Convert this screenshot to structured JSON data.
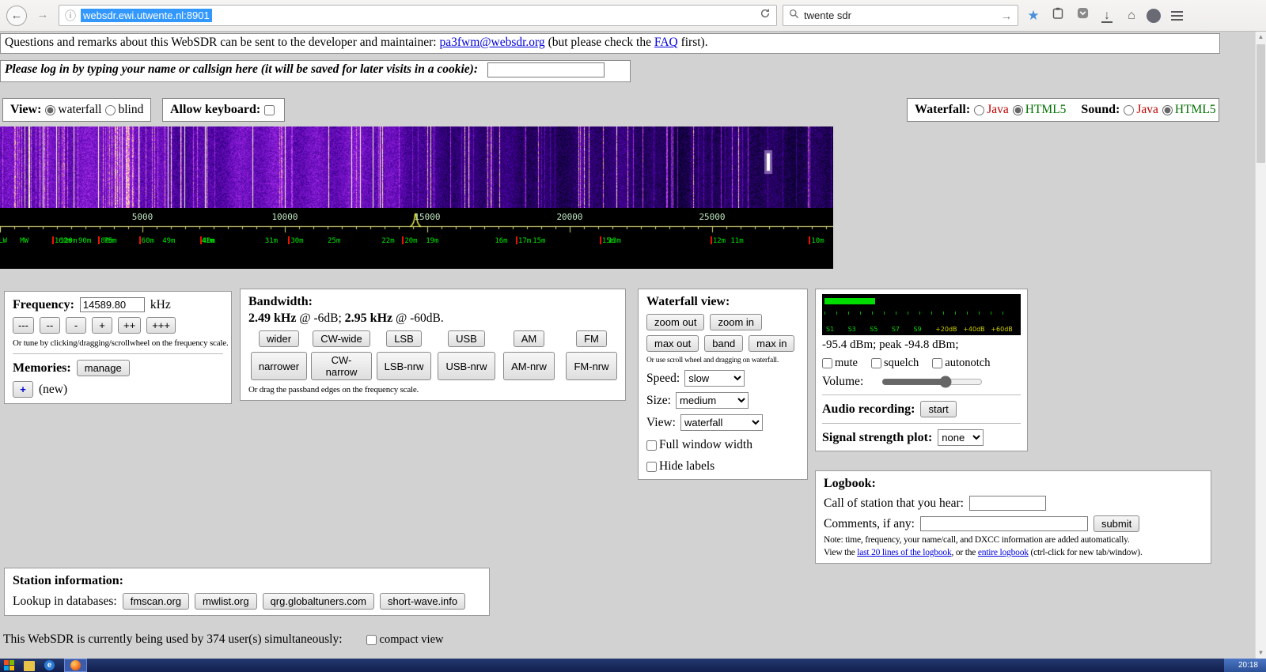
{
  "browser": {
    "url": "websdr.ewi.utwente.nl:8901",
    "search_value": "twente sdr",
    "clock": "20:18"
  },
  "remarks": {
    "pre": "Questions and remarks about this WebSDR can be sent to the developer and maintainer: ",
    "email": "pa3fwm@websdr.org",
    "mid": " (but please check the ",
    "faq": "FAQ",
    "post": " first)."
  },
  "login": {
    "label": "Please log in by typing your name or callsign here (it will be saved for later visits in a cookie):"
  },
  "view_bar": {
    "view_label": "View:",
    "waterfall": "waterfall",
    "blind": "blind",
    "keyboard_label": "Allow keyboard:",
    "wf_tech_label": "Waterfall:",
    "sound_label": "Sound:",
    "java": "Java",
    "html5": "HTML5",
    "checked": "checked"
  },
  "scale": {
    "full_khz": 29250,
    "pointer_khz": 14589.8,
    "ticks": [
      {
        "label": "5000",
        "khz": 5000
      },
      {
        "label": "10000",
        "khz": 10000
      },
      {
        "label": "15000",
        "khz": 15000
      },
      {
        "label": "20000",
        "khz": 20000
      },
      {
        "label": "25000",
        "khz": 25000
      }
    ],
    "bands": [
      {
        "label": "LW",
        "khz": 200
      },
      {
        "label": "MW",
        "khz": 950
      },
      {
        "label": "160m",
        "khz": 1830,
        "ham": true
      },
      {
        "label": "120m",
        "khz": 2350
      },
      {
        "label": "90m",
        "khz": 3000
      },
      {
        "label": "80m",
        "khz": 3450,
        "ham": true
      },
      {
        "label": "75m",
        "khz": 3900
      },
      {
        "label": "60m",
        "khz": 4880,
        "ham": true
      },
      {
        "label": "49m",
        "khz": 5950
      },
      {
        "label": "40m",
        "khz": 7020,
        "ham": true
      },
      {
        "label": "41m",
        "khz": 7320
      },
      {
        "label": "31m",
        "khz": 9550
      },
      {
        "label": "30m",
        "khz": 10120,
        "ham": true
      },
      {
        "label": "25m",
        "khz": 11750
      },
      {
        "label": "22m",
        "khz": 13650
      },
      {
        "label": "20m",
        "khz": 14120,
        "ham": true
      },
      {
        "label": "19m",
        "khz": 15200
      },
      {
        "label": "16m",
        "khz": 17620
      },
      {
        "label": "17m",
        "khz": 18110,
        "ham": true
      },
      {
        "label": "15m",
        "khz": 18950
      },
      {
        "label": "15m",
        "khz": 21050,
        "ham": true
      },
      {
        "label": "13m",
        "khz": 21600
      },
      {
        "label": "12m",
        "khz": 24940,
        "ham": true
      },
      {
        "label": "11m",
        "khz": 25900
      },
      {
        "label": "10m",
        "khz": 28400,
        "ham": true
      }
    ]
  },
  "frequency_panel": {
    "title": "Frequency:",
    "value": "14589.80",
    "unit": "kHz",
    "steps": [
      "---",
      "--",
      "-",
      "+",
      "++",
      "+++"
    ],
    "hint": "Or tune by clicking/dragging/scrollwheel on the frequency scale.",
    "memories_label": "Memories:",
    "manage": "manage",
    "plus": "+",
    "new_label": "(new)"
  },
  "bandwidth_panel": {
    "title": "Bandwidth:",
    "b1": "2.49 kHz",
    "m1": " @ -6dB; ",
    "b2": "2.95 kHz",
    "m2": " @ -60dB.",
    "row1": [
      "wider",
      "CW-wide",
      "LSB",
      "USB",
      "AM",
      "FM"
    ],
    "row2": [
      "narrower",
      "CW-narrow",
      "LSB-nrw",
      "USB-nrw",
      "AM-nrw",
      "FM-nrw"
    ],
    "hint": "Or drag the passband edges on the frequency scale."
  },
  "waterfall_panel": {
    "title": "Waterfall view:",
    "zoom_buttons": [
      "zoom out",
      "zoom in"
    ],
    "max_buttons": [
      "max out",
      "band",
      "max in"
    ],
    "hint": "Or use scroll wheel and dragging on waterfall.",
    "speed_label": "Speed:",
    "speed_value": "slow",
    "size_label": "Size:",
    "size_value": "medium",
    "view_label": "View:",
    "view_value": "waterfall",
    "full_width_label": "Full window width",
    "hide_labels_label": "Hide labels"
  },
  "audio_panel": {
    "smeter_labels": [
      {
        "t": "S1",
        "x": 2
      },
      {
        "t": "S3",
        "x": 13
      },
      {
        "t": "S5",
        "x": 24
      },
      {
        "t": "S7",
        "x": 35
      },
      {
        "t": "S9",
        "x": 46
      },
      {
        "t": "+20dB",
        "x": 57
      },
      {
        "t": "+40dB",
        "x": 71
      },
      {
        "t": "+60dB",
        "x": 85
      }
    ],
    "level_text": "-95.4 dBm; peak -94.8 dBm;",
    "mute": "mute",
    "squelch": "squelch",
    "autonotch": "autonotch",
    "volume_label": "Volume:",
    "volume_value": "65",
    "recording_label": "Audio recording:",
    "start": "start",
    "signal_label": "Signal strength plot:",
    "signal_value": "none"
  },
  "logbook_panel": {
    "title": "Logbook:",
    "call_label": "Call of station that you hear:",
    "comments_label": "Comments, if any:",
    "submit": "submit",
    "note": "Note: time, frequency, your name/call, and DXCC information are added automatically.",
    "view_pre": "View the ",
    "link1": "last 20 lines of the logbook",
    "view_mid": ", or the ",
    "link2": "entire logbook",
    "view_post": " (ctrl-click for new tab/window)."
  },
  "station_panel": {
    "title": "Station information:",
    "lookup_label": "Lookup in databases:",
    "databases": [
      "fmscan.org",
      "mwlist.org",
      "qrg.globaltuners.com",
      "short-wave.info"
    ]
  },
  "footer": {
    "pre": "This WebSDR is currently being used by ",
    "count": "374",
    "post": " user(s) simultaneously:",
    "compact_label": "compact view"
  }
}
